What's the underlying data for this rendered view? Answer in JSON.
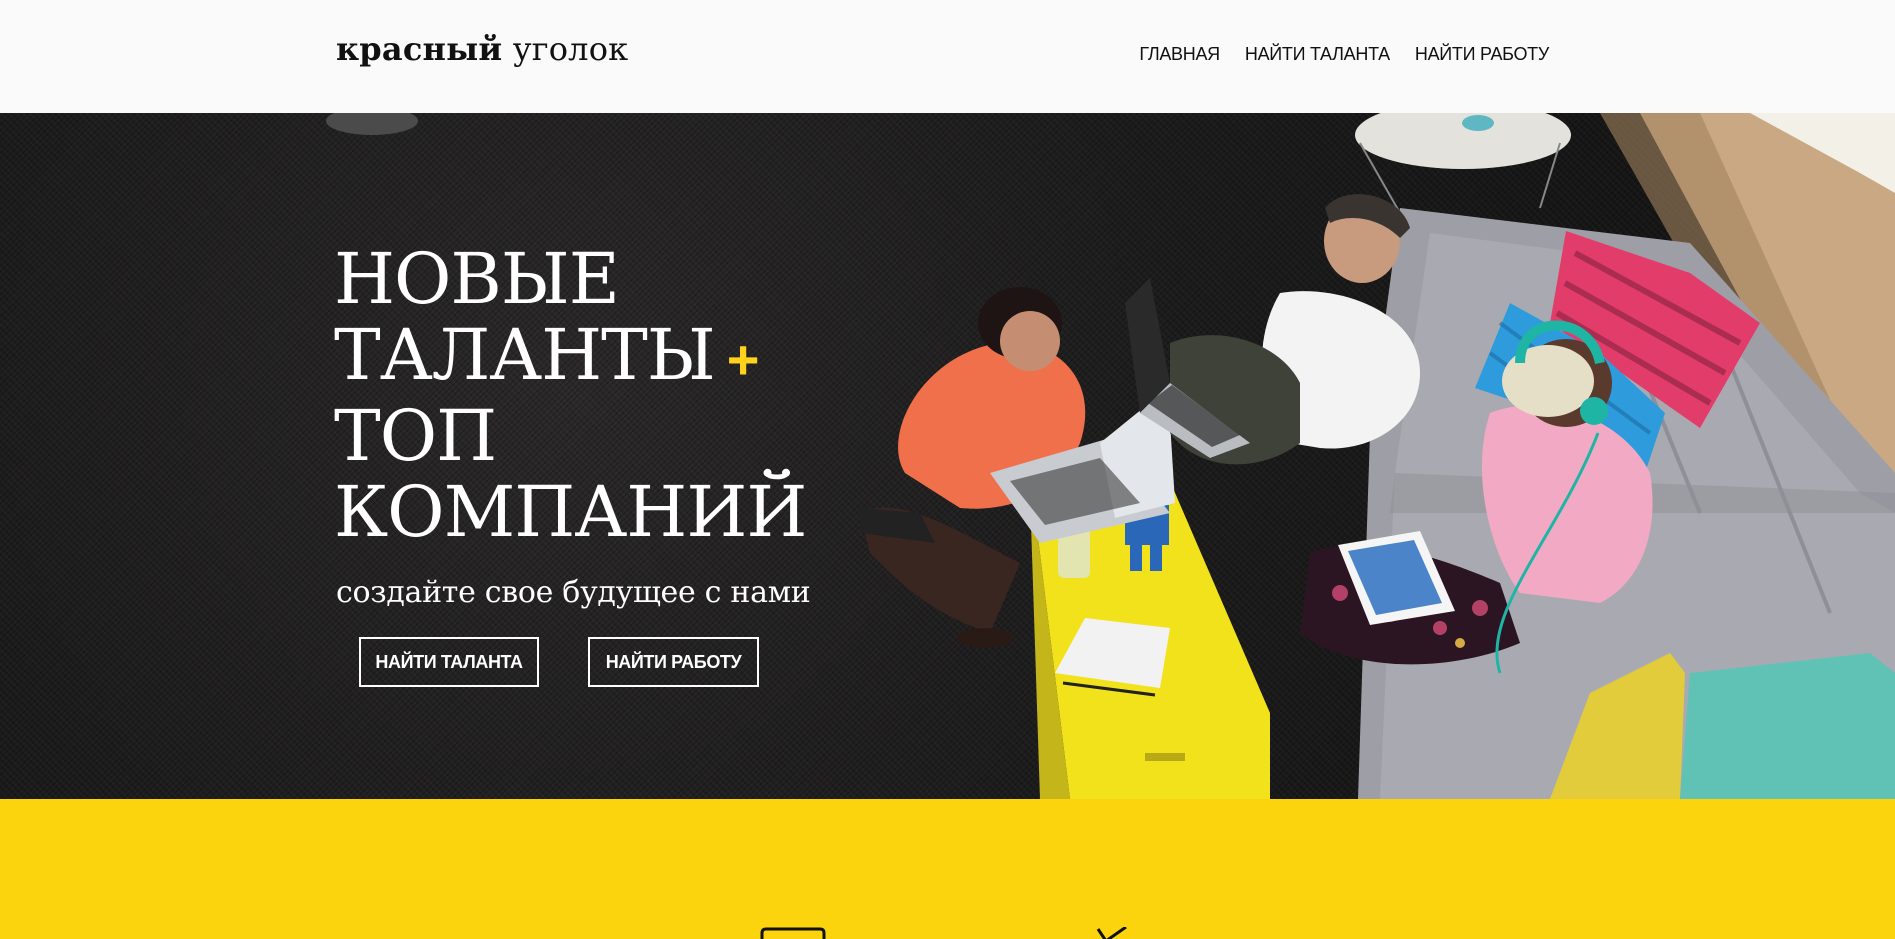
{
  "header": {
    "logo_bold": "красный",
    "logo_thin": "уголок",
    "nav": [
      {
        "label": "ГЛАВНАЯ"
      },
      {
        "label": "НАЙТИ ТАЛАНТА"
      },
      {
        "label": "НАЙТИ РАБОТУ"
      }
    ]
  },
  "hero": {
    "headline_lines": [
      "НОВЫЕ",
      "ТАЛАНТЫ",
      "ТОП",
      "КОМПАНИЙ"
    ],
    "plus_sign": "+",
    "tagline": "создайте свое будущее с нами",
    "buttons": {
      "find_talent": "НАЙТИ ТАЛАНТА",
      "find_work": "НАЙТИ РАБОТУ"
    }
  },
  "colors": {
    "accent_yellow": "#fcd40e",
    "plus_yellow": "#ffd21c",
    "hero_dark": "#1c1b1b",
    "header_bg": "#fafafa"
  },
  "icons": {
    "band_left": "folder-icon",
    "band_right": "check-icon"
  }
}
